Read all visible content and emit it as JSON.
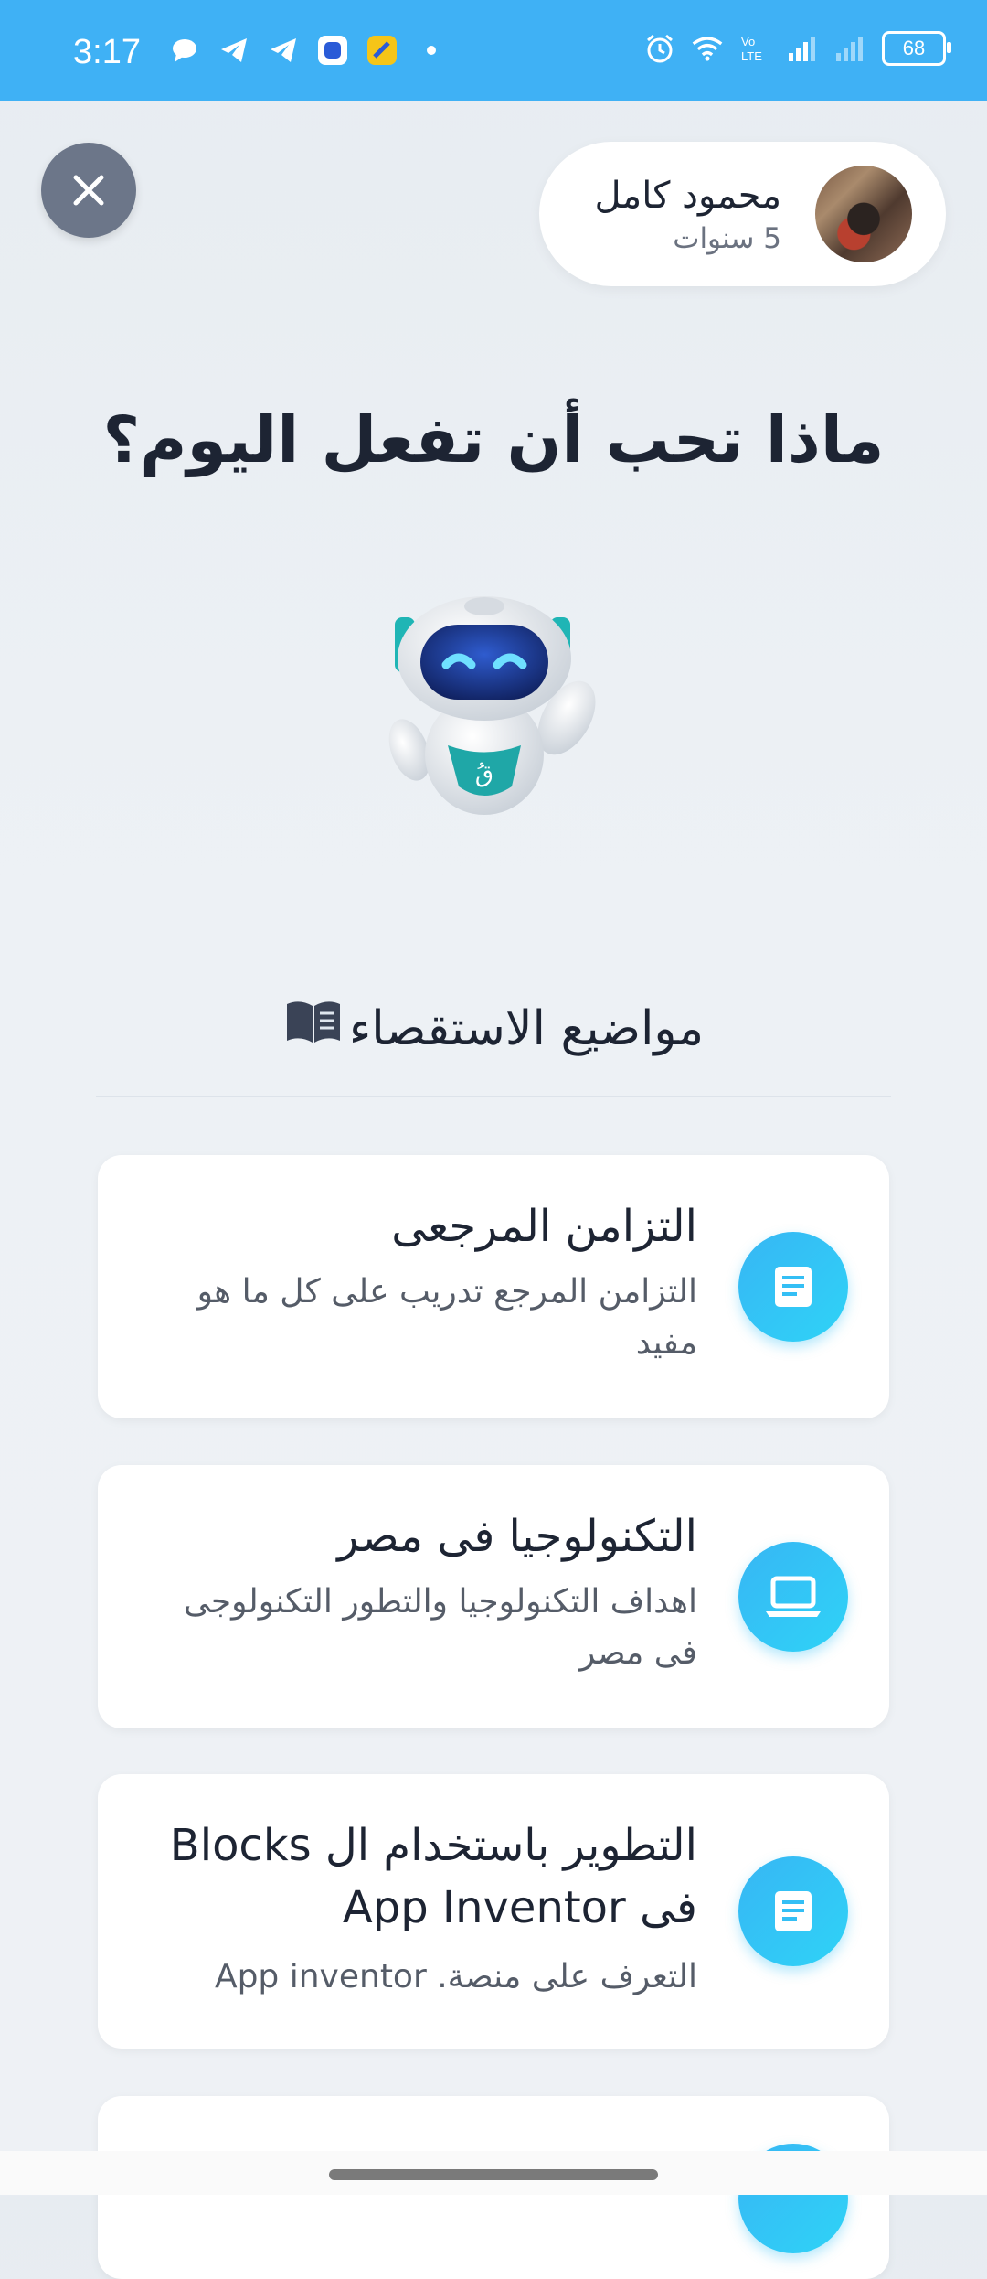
{
  "status_bar": {
    "time": "3:17",
    "left_icons": [
      "chat-bubble-icon",
      "telegram-icon",
      "telegram-icon",
      "app-icon",
      "app-icon",
      "dot-icon"
    ],
    "right_icons": [
      "alarm-icon",
      "wifi-icon",
      "volte-icon",
      "signal-icon",
      "signal-icon"
    ],
    "battery": "68"
  },
  "profile": {
    "name": "محمود كامل",
    "age": "5 سنوات"
  },
  "heading": "ماذا تحب أن تفعل اليوم؟",
  "robot": {
    "badge_letter": "قُ"
  },
  "section": {
    "title": "مواضيع الاستقصاء",
    "icon": "book-icon"
  },
  "topics": [
    {
      "title": "التزامن المرجعى",
      "description": "التزامن المرجع تدريب على كل ما هو مفيد",
      "icon": "document-icon"
    },
    {
      "title": "التكنولوجيا فى مصر",
      "description": "اهداف التكنولوجيا والتطور التكنولوجى فى مصر",
      "icon": "laptop-icon"
    },
    {
      "title": "التطوير باستخدام ال Blocks فى App Inventor",
      "description": "التعرف على منصة. App inventor",
      "icon": "document-icon"
    }
  ],
  "colors": {
    "status_bar": "#3fb1f5",
    "accent": "#2fc4f6",
    "close_button": "#6c7689"
  }
}
